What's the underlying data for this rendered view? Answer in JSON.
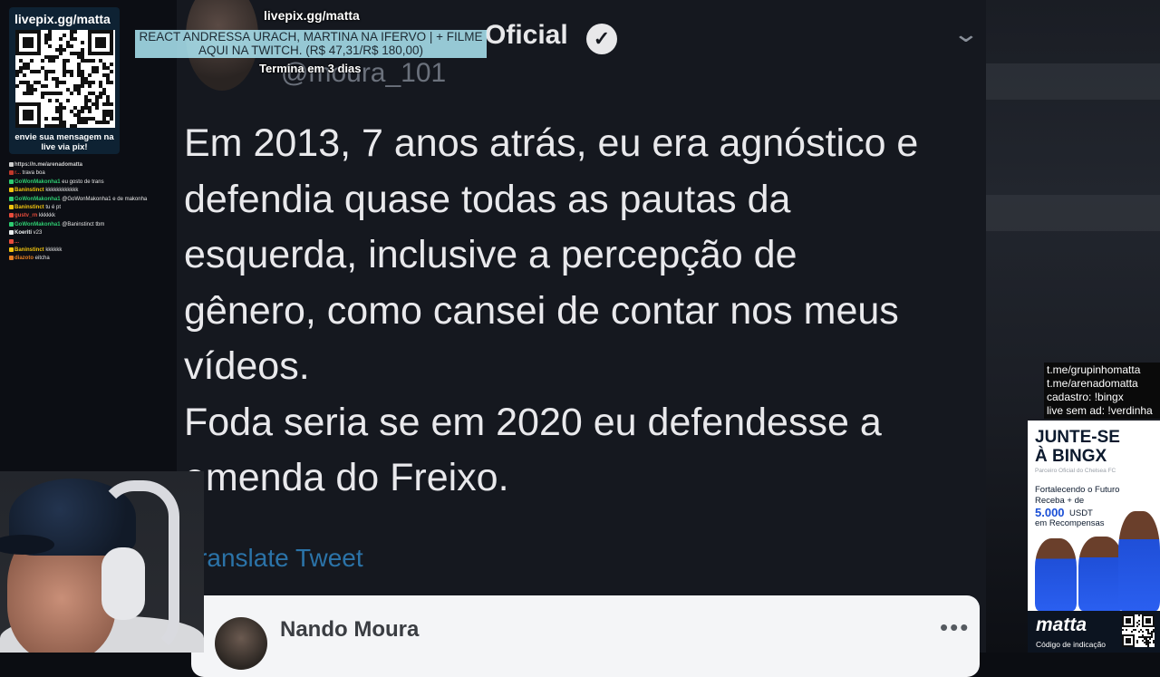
{
  "tweet": {
    "name_partial": "Oficial",
    "handle": "@moura_101",
    "verified_glyph": "✓",
    "chevron": "⌄",
    "lines": [
      "Em 2013, 7 anos atrás, eu era agnóstico e",
      "defendia quase todas as pautas da",
      "esquerda, inclusive a percepção de",
      "gênero, como cansei de contar nos meus",
      "vídeos.",
      "Foda seria se em 2020 eu defendesse a",
      "emenda do Freixo."
    ],
    "translate_label": "Translate Tweet",
    "quote": {
      "name": "Nando Moura",
      "more": "•••"
    }
  },
  "overlay": {
    "livepix_url_top": "livepix.gg/matta",
    "donation_line1": "REACT ANDRESSA URACH, MARTINA NA IFERVO | + FILME",
    "donation_line2": "AQUI NA TWITCH. (R$ 47,31/R$ 180,00)",
    "goal_current": 47.31,
    "goal_target": 180.0,
    "timer": "Termina em 3 dias"
  },
  "livepix_box": {
    "url": "livepix.gg/matta",
    "caption": "envie sua mensagem na live via pix!"
  },
  "chat": [
    {
      "user": "https://n.me/arenadomatta",
      "msg": "",
      "color": "#cfcfcf"
    },
    {
      "user": "r...",
      "msg": "trava boa",
      "color": "#c0392b"
    },
    {
      "user": "GoWonMakonha1",
      "msg": "eu gosto de trans",
      "color": "#2ecc71"
    },
    {
      "user": "Baninstinct",
      "msg": "kkkkkkkkkkkk",
      "color": "#f1c40f"
    },
    {
      "user": "GoWonMakonha1",
      "msg": "@GoWonMakonha1 e de makonha",
      "color": "#2ecc71"
    },
    {
      "user": "Baninstinct",
      "msg": "tu é pt",
      "color": "#f1c40f"
    },
    {
      "user": "gustv_rn",
      "msg": "kkkkkk",
      "color": "#e74c3c"
    },
    {
      "user": "GoWonMakonha1",
      "msg": "@Baninstinct tbm",
      "color": "#2ecc71"
    },
    {
      "user": "Koeriti",
      "msg": "v23",
      "color": "#ecf0f1"
    },
    {
      "user": "...",
      "msg": "",
      "color": "#e74c3c"
    },
    {
      "user": "Baninstinct",
      "msg": "kkkkkk",
      "color": "#f1c40f"
    },
    {
      "user": "diazoto",
      "msg": "eitcha",
      "color": "#e67e22"
    }
  ],
  "info_lines": [
    "t.me/grupinhomatta",
    "t.me/arenadomatta",
    "cadastro: !bingx",
    "live sem ad: !verdinha"
  ],
  "ad": {
    "title_line1": "JUNTE-SE",
    "title_line2": "À BINGX",
    "subtitle": "Parceiro Oficial do Chelsea FC",
    "text_line1": "Fortalecendo o Futuro",
    "text_line2": "Receba + de",
    "amount": "5.000",
    "unit": "USDT",
    "text_line3": "em Recompensas",
    "brand": "matta",
    "code_label": "Código de indicação"
  }
}
